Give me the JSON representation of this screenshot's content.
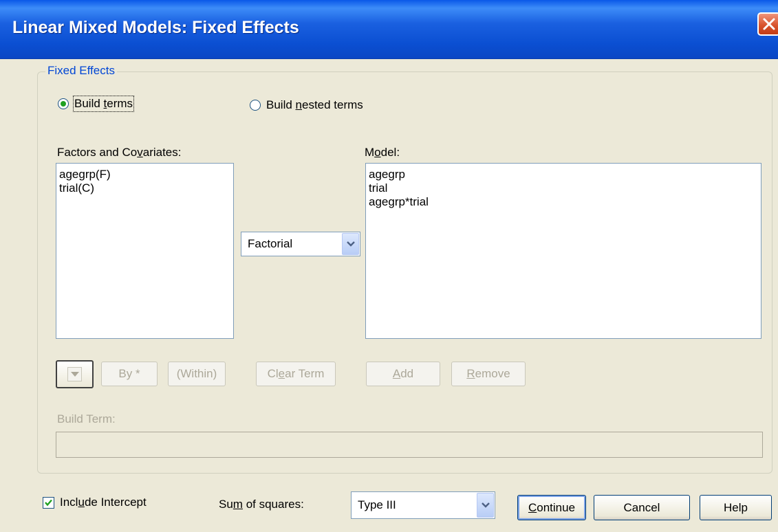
{
  "window": {
    "title": "Linear Mixed Models: Fixed Effects"
  },
  "group": {
    "title": "Fixed Effects"
  },
  "radios": {
    "build_terms": {
      "pre": "Build ",
      "ul": "t",
      "post": "erms",
      "selected": true
    },
    "build_nested": {
      "pre": "Build ",
      "ul": "n",
      "post": "ested terms",
      "selected": false
    }
  },
  "factors": {
    "label": {
      "pre": "Factors and Co",
      "ul": "v",
      "post": "ariates:"
    },
    "items": [
      "agegrp(F)",
      "trial(C)"
    ]
  },
  "model": {
    "label": {
      "pre": "M",
      "ul": "o",
      "post": "del:"
    },
    "items": [
      "agegrp",
      "trial",
      "agegrp*trial"
    ]
  },
  "term_type": {
    "value": "Factorial"
  },
  "buttons": {
    "by": "By *",
    "within": "(Within)",
    "clear_term": {
      "pre": "Cl",
      "ul": "e",
      "post": "ar Term"
    },
    "add": {
      "pre": "",
      "ul": "A",
      "post": "dd"
    },
    "remove": {
      "pre": "",
      "ul": "R",
      "post": "emove"
    },
    "continue": {
      "pre": "",
      "ul": "C",
      "post": "ontinue"
    },
    "cancel": "Cancel",
    "help": "Help"
  },
  "build_term": {
    "label": "Build Term:",
    "value": ""
  },
  "include_intercept": {
    "pre": "Incl",
    "ul": "u",
    "post": "de Intercept",
    "checked": true
  },
  "sum_of_squares": {
    "label": {
      "pre": "Su",
      "ul": "m",
      "post": " of squares:"
    },
    "value": "Type III"
  },
  "colors": {
    "title_bar": "#0a58e8",
    "dialog_bg": "#ece9d8",
    "group_title": "#0046d5",
    "radio_dot": "#21a121"
  },
  "icons": [
    "close-icon",
    "chevron-down-icon",
    "down-arrow-icon",
    "checkmark-icon"
  ]
}
